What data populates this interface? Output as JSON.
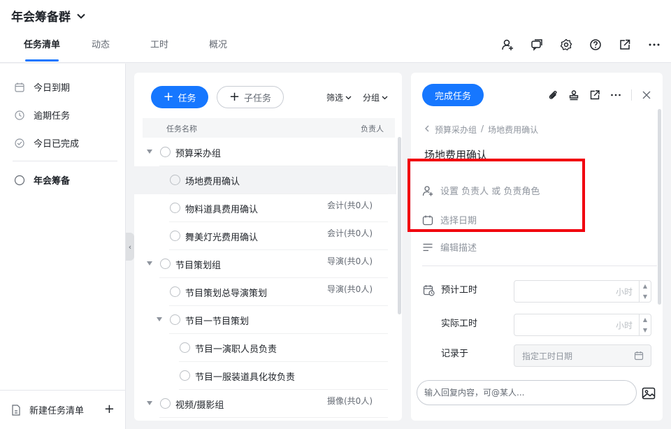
{
  "header": {
    "title": "年会筹备群",
    "tabs": [
      {
        "label": "任务清单",
        "active": true
      },
      {
        "label": "动态"
      },
      {
        "label": "工时"
      },
      {
        "label": "概况"
      }
    ],
    "icons": [
      "add-member-icon",
      "chat-icon",
      "settings-icon",
      "help-icon",
      "external-link-icon",
      "more-icon"
    ]
  },
  "sidebar": {
    "items": [
      {
        "label": "今日到期",
        "icon": "calendar-icon"
      },
      {
        "label": "逾期任务",
        "icon": "clock-icon"
      },
      {
        "label": "今日已完成",
        "icon": "check-circle-icon"
      },
      {
        "label": "年会筹备",
        "icon": "circle-icon"
      }
    ],
    "new_list_label": "新建任务清单"
  },
  "task_list": {
    "add_task_label": "任务",
    "add_subtask_label": "子任务",
    "filter_label": "筛选",
    "group_label": "分组",
    "columns": {
      "name": "任务名称",
      "owner": "负责人"
    },
    "rows": [
      {
        "name": "预算采办组",
        "owner": "",
        "level": 0,
        "expandable": true
      },
      {
        "name": "场地费用确认",
        "owner": "",
        "level": 1,
        "selected": true
      },
      {
        "name": "物料道具费用确认",
        "owner": "会计(共0人)",
        "level": 1
      },
      {
        "name": "舞美灯光费用确认",
        "owner": "会计(共0人)",
        "level": 1
      },
      {
        "name": "节目策划组",
        "owner": "导演(共0人)",
        "level": 0,
        "expandable": true
      },
      {
        "name": "节目策划总导演策划",
        "owner": "导演(共0人)",
        "level": 1
      },
      {
        "name": "节目一节目策划",
        "owner": "",
        "level": 1,
        "expandable": true
      },
      {
        "name": "节目一演职人员负责",
        "owner": "",
        "level": 2
      },
      {
        "name": "节目一服装道具化妆负责",
        "owner": "",
        "level": 2
      },
      {
        "name": "视频/摄影组",
        "owner": "摄像(共0人)",
        "level": 0,
        "expandable": true
      }
    ]
  },
  "detail": {
    "complete_label": "完成任务",
    "breadcrumb": [
      "预算采办组",
      "/",
      "场地费用确认"
    ],
    "title": "场地费用确认",
    "assignee_placeholder": "设置  负责人  或  负责角色",
    "date_placeholder": "选择日期",
    "desc_placeholder": "编辑描述",
    "worktime": {
      "estimated_label": "预计工时",
      "actual_label": "实际工时",
      "unit": "小时",
      "recorded_label": "记录于",
      "date_placeholder": "指定工时日期"
    },
    "reply_placeholder": "输入回复内容，可@某人..."
  },
  "colors": {
    "accent": "#1677ff",
    "annotation": "#f1000e"
  }
}
